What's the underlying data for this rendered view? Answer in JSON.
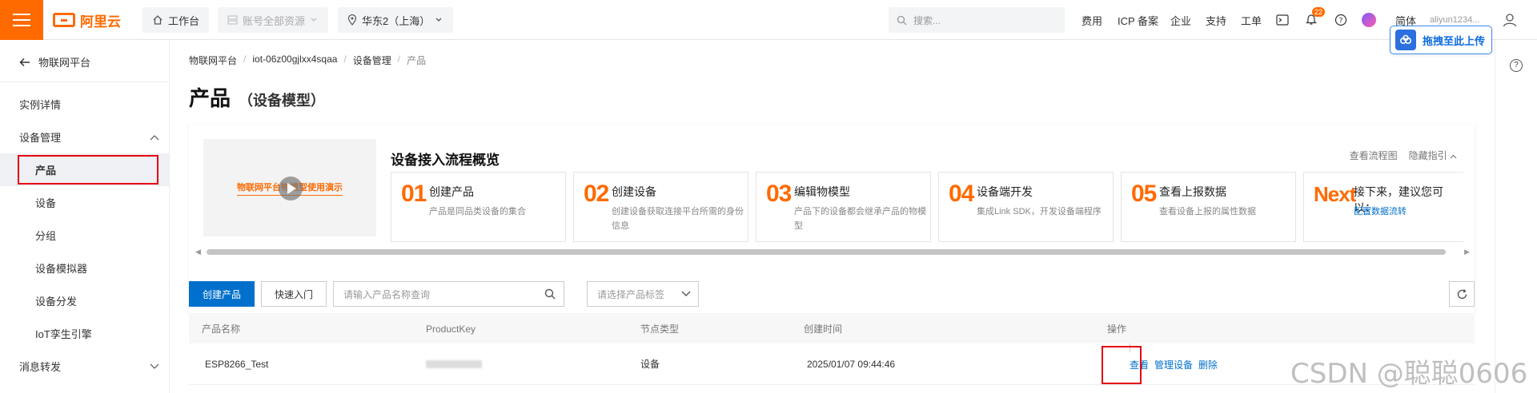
{
  "topbar": {
    "logo_text": "阿里云",
    "workbench": "工作台",
    "resources": "账号全部资源",
    "region": "华东2（上海）",
    "search_placeholder": "搜索...",
    "nav": [
      "费用",
      "ICP 备案",
      "企业",
      "支持",
      "工单"
    ],
    "notification_count": "22",
    "lang": "简体",
    "account": "aliyun1234..."
  },
  "sidebar": {
    "back_label": "物联网平台",
    "items": [
      {
        "label": "实例详情"
      },
      {
        "label": "设备管理"
      },
      {
        "label": "产品"
      },
      {
        "label": "设备"
      },
      {
        "label": "分组"
      },
      {
        "label": "设备模拟器"
      },
      {
        "label": "设备分发"
      },
      {
        "label": "IoT孪生引擎"
      },
      {
        "label": "消息转发"
      }
    ]
  },
  "breadcrumb": [
    "物联网平台",
    "iot-06z00gjlxx4sqaa",
    "设备管理",
    "产品"
  ],
  "page": {
    "title": "产品",
    "subtitle": "（设备模型）"
  },
  "flow": {
    "video_text": "物联网平台物模型使用演示",
    "title": "设备接入流程概览",
    "link_flowchart": "查看流程图",
    "link_hide": "隐藏指引",
    "steps": [
      {
        "num": "01",
        "title": "创建产品",
        "desc": "产品是同品类设备的集合"
      },
      {
        "num": "02",
        "title": "创建设备",
        "desc": "创建设备获取连接平台所需的身份信息"
      },
      {
        "num": "03",
        "title": "编辑物模型",
        "desc": "产品下的设备都会继承产品的物模型"
      },
      {
        "num": "04",
        "title": "设备端开发",
        "desc": "集成Link SDK，开发设备端程序"
      },
      {
        "num": "05",
        "title": "查看上报数据",
        "desc": "查看设备上报的属性数据"
      },
      {
        "num": "Next",
        "title": "接下来，建议您可以：",
        "desc": "配置数据流转"
      }
    ]
  },
  "toolbar": {
    "create_label": "创建产品",
    "quickstart_label": "快速入门",
    "search_placeholder": "请输入产品名称查询",
    "tag_placeholder": "请选择产品标签"
  },
  "table": {
    "headers": [
      "产品名称",
      "ProductKey",
      "节点类型",
      "创建时间",
      "操作"
    ],
    "rows": [
      {
        "name": "ESP8266_Test",
        "node_type": "设备",
        "created": "2025/01/07 09:44:46",
        "ops": [
          "查看",
          "管理设备",
          "删除"
        ]
      }
    ]
  },
  "float_upload": "拖拽至此上传",
  "watermark": "CSDN @聪聪0606",
  "colors": {
    "brand": "#ff6a00",
    "primary": "#0070cc",
    "highlight": "#e60012"
  }
}
